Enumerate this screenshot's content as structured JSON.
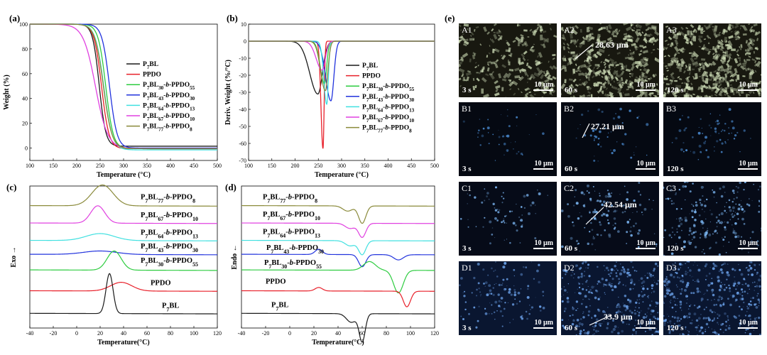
{
  "panels": {
    "a": "(a)",
    "b": "(b)",
    "c": "(c)",
    "d": "(d)",
    "e": "(e)"
  },
  "colors": {
    "P7BL": "#1a1a1a",
    "PPDO": "#e8202a",
    "P7BL30-b-PPDO55": "#2ecc40",
    "P7BL43-b-PPDO30": "#2233dd",
    "P7BL64-b-PPDO13": "#40e0e0",
    "P7BL67-b-PPDO10": "#e040e0",
    "P7BL77-b-PPDO8": "#8a8a3a"
  },
  "legend": [
    {
      "key": "P7BL",
      "parts": [
        [
          "P",
          ""
        ],
        [
          "7",
          "sub"
        ],
        [
          "BL",
          ""
        ]
      ]
    },
    {
      "key": "PPDO",
      "parts": [
        [
          "PPDO",
          ""
        ]
      ]
    },
    {
      "key": "P7BL30-b-PPDO55",
      "parts": [
        [
          "P",
          ""
        ],
        [
          "7",
          "sub"
        ],
        [
          "BL",
          ""
        ],
        [
          "30",
          "sub"
        ],
        [
          "-",
          ""
        ],
        [
          "b",
          "i"
        ],
        [
          "-PPDO",
          ""
        ],
        [
          "55",
          "sub"
        ]
      ]
    },
    {
      "key": "P7BL43-b-PPDO30",
      "parts": [
        [
          "P",
          ""
        ],
        [
          "7",
          "sub"
        ],
        [
          "BL",
          ""
        ],
        [
          "43",
          "sub"
        ],
        [
          "-",
          ""
        ],
        [
          "b",
          "i"
        ],
        [
          "-PPDO",
          ""
        ],
        [
          "30",
          "sub"
        ]
      ]
    },
    {
      "key": "P7BL64-b-PPDO13",
      "parts": [
        [
          "P",
          ""
        ],
        [
          "7",
          "sub"
        ],
        [
          "BL",
          ""
        ],
        [
          "64",
          "sub"
        ],
        [
          "-",
          ""
        ],
        [
          "b",
          "i"
        ],
        [
          "-PPDO",
          ""
        ],
        [
          "13",
          "sub"
        ]
      ]
    },
    {
      "key": "P7BL67-b-PPDO10",
      "parts": [
        [
          "P",
          ""
        ],
        [
          "7",
          "sub"
        ],
        [
          "BL",
          ""
        ],
        [
          "67",
          "sub"
        ],
        [
          "-",
          ""
        ],
        [
          "b",
          "i"
        ],
        [
          "-PPDO",
          ""
        ],
        [
          "10",
          "sub"
        ]
      ]
    },
    {
      "key": "P7BL77-b-PPDO8",
      "parts": [
        [
          "P",
          ""
        ],
        [
          "7",
          "sub"
        ],
        [
          "BL",
          ""
        ],
        [
          "77",
          "sub"
        ],
        [
          "-",
          ""
        ],
        [
          "b",
          "i"
        ],
        [
          "-PPDO",
          ""
        ],
        [
          "8",
          "sub"
        ]
      ]
    }
  ],
  "chart_data": [
    {
      "id": "a",
      "type": "line",
      "xlabel": "Temperature (°C)",
      "ylabel": "Weight (%)",
      "xlim": [
        100,
        500
      ],
      "ylim": [
        -10,
        100
      ],
      "xticks": [
        100,
        150,
        200,
        250,
        300,
        350,
        400,
        450,
        500
      ],
      "yticks": [
        0,
        20,
        40,
        60,
        80,
        100
      ],
      "legend_position": "center-right",
      "series": [
        {
          "key": "P7BL",
          "mid": 248,
          "width": 7,
          "end": 1.5
        },
        {
          "key": "PPDO",
          "mid": 253,
          "width": 8,
          "end": -0.5
        },
        {
          "key": "P7BL30-b-PPDO55",
          "mid": 262,
          "width": 8,
          "end": -0.5
        },
        {
          "key": "P7BL43-b-PPDO30",
          "mid": 270,
          "width": 8,
          "end": 0
        },
        {
          "key": "P7BL64-b-PPDO13",
          "mid": 258,
          "width": 9,
          "end": -1.5
        },
        {
          "key": "P7BL67-b-PPDO10",
          "mid": 240,
          "width": 13,
          "end": -0.5
        },
        {
          "key": "P7BL77-b-PPDO8",
          "mid": 257,
          "width": 9,
          "end": -0.5
        }
      ]
    },
    {
      "id": "b",
      "type": "line",
      "xlabel": "Temperature (°C)",
      "ylabel": "Deriv. Weight (%/°C)",
      "xlim": [
        100,
        500
      ],
      "ylim": [
        -70,
        10
      ],
      "xticks": [
        100,
        150,
        200,
        250,
        300,
        350,
        400,
        450,
        500
      ],
      "yticks": [
        10,
        0,
        -10,
        -20,
        -30,
        -40,
        -50,
        -60,
        -70
      ],
      "legend_position": "center-right",
      "series": [
        {
          "key": "P7BL",
          "peak_x": 249,
          "peak_y": -31,
          "width": 14
        },
        {
          "key": "PPDO",
          "peak_x": 260,
          "peak_y": -63,
          "width": 3.5
        },
        {
          "key": "P7BL30-b-PPDO55",
          "peak_x": 263,
          "peak_y": -25,
          "width": 7
        },
        {
          "key": "P7BL43-b-PPDO30",
          "peak_x": 277,
          "peak_y": -35,
          "width": 9
        },
        {
          "key": "P7BL64-b-PPDO13",
          "peak_x": 268,
          "peak_y": -37,
          "width": 5
        },
        {
          "key": "P7BL67-b-PPDO10",
          "peak_x": 258,
          "peak_y": -17,
          "width": 10
        },
        {
          "key": "P7BL77-b-PPDO8",
          "peak_x": 265,
          "peak_y": -29,
          "width": 8
        }
      ]
    },
    {
      "id": "c",
      "type": "line",
      "xlabel": "Temperature(°C)",
      "ylabel": "Exo →",
      "xlim": [
        -40,
        120
      ],
      "xticks": [
        -40,
        -20,
        0,
        20,
        40,
        60,
        80,
        100,
        120
      ],
      "series": [
        {
          "key": "P7BL77-b-PPDO8",
          "baseline": 7,
          "peaks": [
            [
              22,
              1.2,
              9
            ]
          ]
        },
        {
          "key": "P7BL67-b-PPDO10",
          "baseline": 6,
          "peaks": [
            [
              18,
              1.0,
              6
            ]
          ]
        },
        {
          "key": "P7BL64-b-PPDO13",
          "baseline": 5,
          "peaks": [
            [
              20,
              0.4,
              12
            ]
          ]
        },
        {
          "key": "P7BL43-b-PPDO30",
          "baseline": 4.2,
          "peaks": [
            [
              20,
              0.2,
              14
            ]
          ]
        },
        {
          "key": "P7BL30-b-PPDO55",
          "baseline": 3.3,
          "peaks": [
            [
              32,
              1.1,
              6
            ]
          ]
        },
        {
          "key": "PPDO",
          "baseline": 2.1,
          "peaks": [
            [
              38,
              0.5,
              9
            ]
          ]
        },
        {
          "key": "P7BL",
          "baseline": 0.8,
          "peaks": [
            [
              28,
              2.3,
              3
            ]
          ]
        }
      ]
    },
    {
      "id": "d",
      "type": "line",
      "xlabel": "Temperature(°C)",
      "ylabel": "Endo ←",
      "xlim": [
        -40,
        120
      ],
      "xticks": [
        -40,
        -20,
        0,
        20,
        40,
        60,
        80,
        100,
        120
      ],
      "series": [
        {
          "key": "P7BL77-b-PPDO8",
          "baseline": 7,
          "peaks": [
            [
              60,
              -1.0,
              3
            ],
            [
              48,
              -0.3,
              4
            ]
          ]
        },
        {
          "key": "P7BL67-b-PPDO10",
          "baseline": 6,
          "peaks": [
            [
              60,
              -0.8,
              3
            ],
            [
              50,
              -0.3,
              4
            ]
          ]
        },
        {
          "key": "P7BL64-b-PPDO13",
          "baseline": 5,
          "peaks": [
            [
              60,
              -0.8,
              3
            ],
            [
              50,
              -0.3,
              4
            ]
          ]
        },
        {
          "key": "P7BL43-b-PPDO30",
          "baseline": 4.2,
          "peaks": [
            [
              24,
              0.3,
              3
            ],
            [
              60,
              -0.7,
              3
            ],
            [
              90,
              -0.3,
              4
            ]
          ]
        },
        {
          "key": "P7BL30-b-PPDO55",
          "baseline": 3.3,
          "peaks": [
            [
              66,
              0.5,
              5
            ],
            [
              90,
              -1.3,
              4
            ]
          ]
        },
        {
          "key": "PPDO",
          "baseline": 2.1,
          "peaks": [
            [
              24,
              0.2,
              3
            ],
            [
              97,
              -0.9,
              3
            ]
          ]
        },
        {
          "key": "P7BL",
          "baseline": 0.8,
          "peaks": [
            [
              51,
              -0.5,
              4
            ],
            [
              60,
              -1.6,
              2.5
            ]
          ]
        }
      ]
    }
  ],
  "micrographs": {
    "scale": "10 μm",
    "rows": [
      {
        "ids": [
          "A1",
          "A2",
          "A3"
        ],
        "times": [
          "3 s",
          "60 s",
          "120 s"
        ],
        "measure": "28.63 μm",
        "tone": "#d8e8c0",
        "bg": "#181810",
        "density": [
          0.5,
          0.95,
          1.0
        ]
      },
      {
        "ids": [
          "B1",
          "B2",
          "B3"
        ],
        "times": [
          "3 s",
          "60 s",
          "120 s"
        ],
        "measure": "27.21 μm",
        "tone": "#4a8ad0",
        "bg": "#050912",
        "density": [
          0.05,
          0.08,
          0.12
        ]
      },
      {
        "ids": [
          "C1",
          "C2",
          "C3"
        ],
        "times": [
          "3 s",
          "60 s",
          "120 s"
        ],
        "measure": "42.54 μm",
        "tone": "#7ab4f0",
        "bg": "#060b18",
        "density": [
          0.12,
          0.3,
          0.55
        ]
      },
      {
        "ids": [
          "D1",
          "D2",
          "D3"
        ],
        "times": [
          "3 s",
          "60 s",
          "120 s"
        ],
        "measure": "33.9 μm",
        "tone": "#6aa0e8",
        "bg": "#0a1630",
        "density": [
          0.25,
          0.75,
          0.95
        ]
      }
    ]
  }
}
